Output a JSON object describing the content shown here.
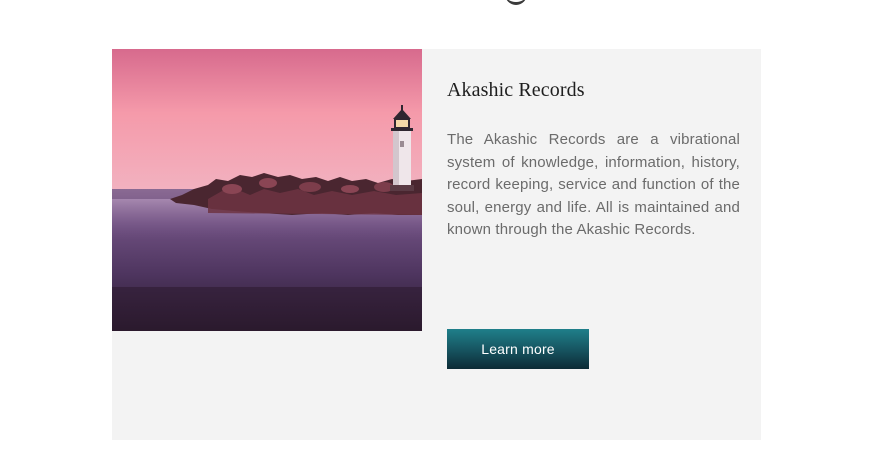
{
  "card": {
    "image_alt": "Lighthouse on a rocky jetty at dusk",
    "title": "Akashic Records",
    "description": "The Akashic Records are a vibrational system of knowledge, information, history, record keeping, service and function of the soul, energy and life. All is maintained and known through the Akashic Records.",
    "button_label": "Learn more"
  },
  "colors": {
    "card_background": "#f3f3f3",
    "button_gradient_top": "#1f7f8a",
    "button_gradient_bottom": "#0c2a35",
    "title_text": "#1e1e1e",
    "body_text": "#6b6b6b"
  }
}
